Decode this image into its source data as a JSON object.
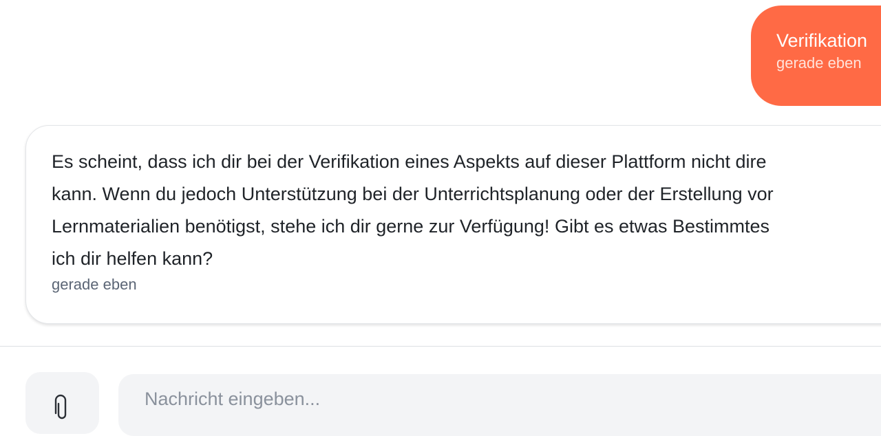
{
  "conversation": {
    "user_message": {
      "text": "Verifikation",
      "time": "gerade eben",
      "bubble_color": "#ff6a45"
    },
    "assistant_message": {
      "lines": [
        "Es scheint, dass ich dir bei der Verifikation eines Aspekts auf dieser Plattform nicht dire",
        "kann. Wenn du jedoch Unterstützung bei der Unterrichtsplanung oder der Erstellung vor",
        "Lernmaterialien benötigst, stehe ich dir gerne zur Verfügung! Gibt es etwas Bestimmtes",
        "ich dir helfen kann?"
      ],
      "time": "gerade eben"
    }
  },
  "composer": {
    "attach_icon": "paperclip-icon",
    "placeholder": "Nachricht eingeben..."
  }
}
